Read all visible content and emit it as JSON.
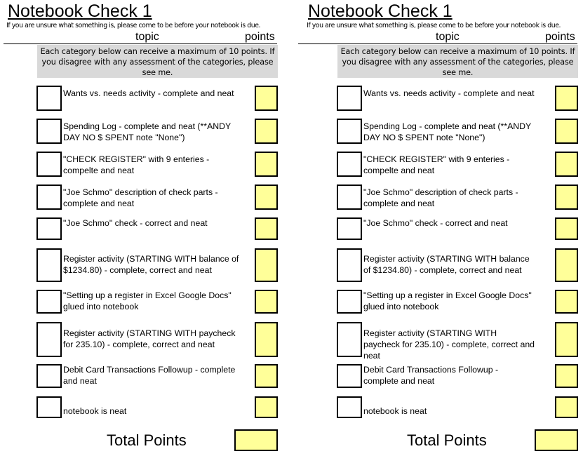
{
  "sheets": [
    {
      "title": "Notebook Check 1",
      "subtitle": "If you are unsure what something is, please come to be before your notebook is due.",
      "header_topic": "topic",
      "header_points": "points",
      "note": "Each category below can receive a maximum of 10 points.  If you disagree with any assessment of the categories, please see me.",
      "total_label": "Total Points"
    },
    {
      "title": "Notebook Check 1",
      "subtitle": "If you are unsure what something is, please come to be before your notebook is due.",
      "header_topic": "topic",
      "header_points": "points",
      "note": "Each category below can receive a maximum of 10 points.  If you disagree with any assessment of the categories, please see me.",
      "total_label": "Total Points"
    }
  ],
  "items": [
    "Wants vs. needs activity - complete and neat",
    "Spending Log - complete and neat (**ANDY DAY NO $ SPENT note \"None\")",
    "\"CHECK REGISTER\" with 9 enteries - compelte and neat",
    "\"Joe Schmo\" description of check parts - complete and neat",
    "\"Joe Schmo\" check - correct and neat",
    "Register activity (STARTING WITH balance of $1234.80) - complete, correct and neat",
    "\"Setting up a register in Excel Google Docs\" glued into notebook",
    "Register activity (STARTING WITH paycheck for 235.10) - complete, correct and neat",
    "Debit Card Transactions Followup - complete and neat",
    "notebook is neat"
  ],
  "colors": {
    "points_box_fill": "#ffff99",
    "note_background": "#d9d9d9"
  }
}
